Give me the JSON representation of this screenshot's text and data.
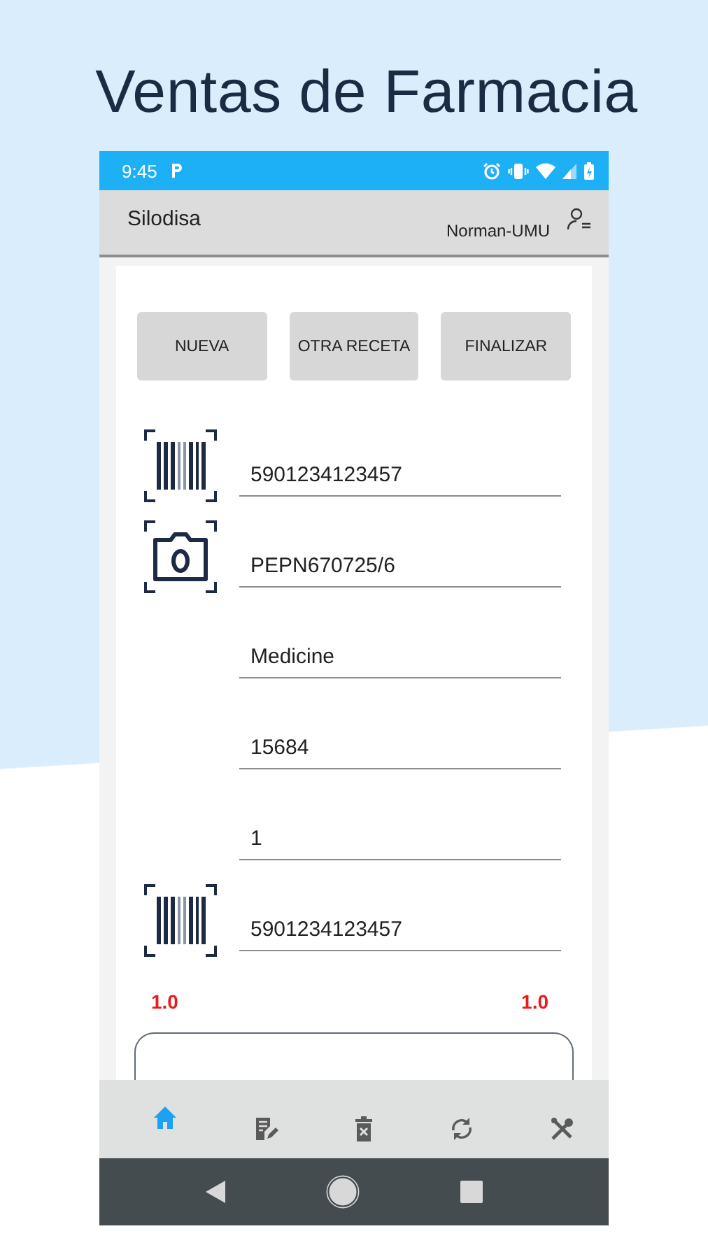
{
  "headline": "Ventas de Farmacia",
  "status_bar": {
    "time": "9:45"
  },
  "app_bar": {
    "title": "Silodisa",
    "user": "Norman-UMU"
  },
  "buttons": [
    "NUEVA",
    "OTRA RECETA",
    "FINALIZAR"
  ],
  "fields": [
    {
      "kind": "barcode",
      "value": "5901234123457"
    },
    {
      "kind": "camera",
      "value": "PEPN670725/6"
    },
    {
      "kind": "plain",
      "value": "Medicine"
    },
    {
      "kind": "plain",
      "value": "15684"
    },
    {
      "kind": "plain",
      "value": "1"
    },
    {
      "kind": "barcode",
      "value": "5901234123457"
    }
  ],
  "totals": [
    "1.0",
    "1.0"
  ],
  "bottom_nav": [
    {
      "kind": "home",
      "selected": true
    },
    {
      "kind": "edit",
      "selected": false
    },
    {
      "kind": "delete",
      "selected": false
    },
    {
      "kind": "sync",
      "selected": false
    },
    {
      "kind": "tools",
      "selected": false
    }
  ]
}
